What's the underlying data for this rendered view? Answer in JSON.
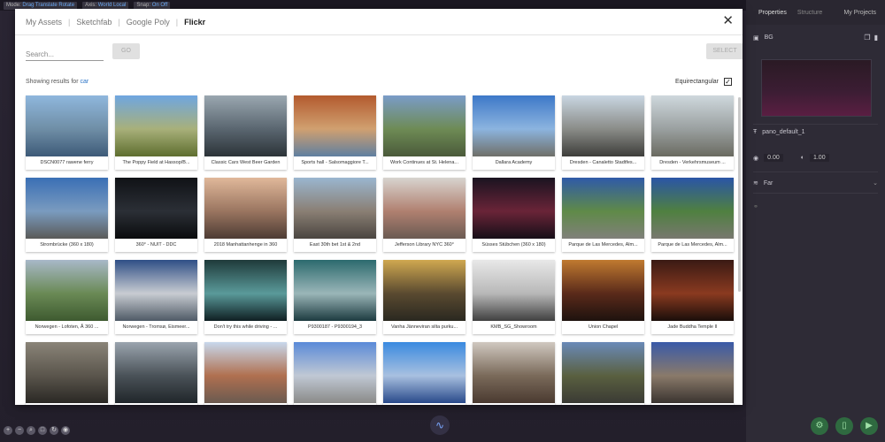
{
  "topbar": {
    "mode_label": "Mode:",
    "mode_values": "Drag  Translate  Rotate",
    "axis_label": "Axis:",
    "axis_values": "World  Local",
    "snap_label": "Snap:",
    "snap_values": "On  Off"
  },
  "right_panel": {
    "tabs": [
      "Properties",
      "Structure"
    ],
    "my_projects": "My Projects",
    "bg_label": "BG",
    "pano_name": "pano_default_1",
    "value_a": "0.00",
    "value_b": "1.00",
    "far_label": "Far"
  },
  "modal": {
    "tabs": [
      {
        "label": "My Assets",
        "active": false
      },
      {
        "label": "Sketchfab",
        "active": false
      },
      {
        "label": "Google Poly",
        "active": false
      },
      {
        "label": "Flickr",
        "active": true
      }
    ],
    "search_placeholder": "Search...",
    "go_label": "GO",
    "select_label": "SELECT",
    "results_prefix": "Showing results for",
    "query": "car",
    "equirectangular_label": "Equirectangular",
    "equirectangular_checked": true,
    "items": [
      {
        "caption": "DSCN0077 rawene ferry",
        "colors": [
          "#8fb7dd",
          "#6f8ea6",
          "#3d5a78"
        ]
      },
      {
        "caption": "The Poppy Field at Hassop/B...",
        "colors": [
          "#6fa6e0",
          "#a8b07a",
          "#5e6e2f"
        ]
      },
      {
        "caption": "Classic Cars West Beer Garden",
        "colors": [
          "#9aa7b0",
          "#5a6670",
          "#2c3338"
        ]
      },
      {
        "caption": "Sports hall - Salsomaggiore T...",
        "colors": [
          "#b35a2e",
          "#d0a070",
          "#5f7fa0"
        ]
      },
      {
        "caption": "Work Continues at St. Helena...",
        "colors": [
          "#7a9cc8",
          "#6e8b55",
          "#4a5a3a"
        ]
      },
      {
        "caption": "Dallara Academy",
        "colors": [
          "#3d78c8",
          "#8cb4df",
          "#6f6f68"
        ]
      },
      {
        "caption": "Dresden - Canaletto Stadtfes...",
        "colors": [
          "#c9d6e2",
          "#8a8c88",
          "#3d3d3a"
        ]
      },
      {
        "caption": "Dresden - Verkehrsmuseum ...",
        "colors": [
          "#cfd8dd",
          "#9aa0a0",
          "#6a6a60"
        ]
      },
      {
        "caption": "Strombrücke (360 x 180)",
        "colors": [
          "#3a6fb5",
          "#7a9bbf",
          "#5a5a58"
        ]
      },
      {
        "caption": "360° - NUIT - DDC",
        "colors": [
          "#101216",
          "#2b2f36",
          "#0a0b0d"
        ]
      },
      {
        "caption": "2018 Manhattanhenge in 360",
        "colors": [
          "#e0b89a",
          "#9a7560",
          "#4d3c34"
        ]
      },
      {
        "caption": "East 30th bet 1st & 2nd",
        "colors": [
          "#9ab6cf",
          "#8a7f74",
          "#4a4540"
        ]
      },
      {
        "caption": "Jefferson Library NYC 360°",
        "colors": [
          "#d8d4cf",
          "#b08070",
          "#6a5a52"
        ]
      },
      {
        "caption": "Süsses Stübchen (360 x 180)",
        "colors": [
          "#1a1320",
          "#6a2438",
          "#160f18"
        ]
      },
      {
        "caption": "Parque de Las Mercedes, Alm...",
        "colors": [
          "#2f5aa8",
          "#5f8a48",
          "#80807a"
        ]
      },
      {
        "caption": "Parque de Las Mercedes, Alm...",
        "colors": [
          "#2a55a6",
          "#4f8040",
          "#78786f"
        ]
      },
      {
        "caption": "Norwegen - Lofoten, Å 360 ...",
        "colors": [
          "#a8b8c8",
          "#6a8a55",
          "#3e5a30"
        ]
      },
      {
        "caption": "Norwegen - Tromsø, Eismeer...",
        "colors": [
          "#2f4f86",
          "#c8ccd2",
          "#4f5a66"
        ]
      },
      {
        "caption": "Don't try this while driving - ...",
        "colors": [
          "#1f3a3a",
          "#5a9a9a",
          "#0f1f22"
        ]
      },
      {
        "caption": "P9300187 - P9300194_3",
        "colors": [
          "#2c6a6e",
          "#9ab6b8",
          "#1d3b40"
        ]
      },
      {
        "caption": "Vanha Jänneviran silta purku...",
        "colors": [
          "#d0a850",
          "#5a4a30",
          "#2a2820"
        ]
      },
      {
        "caption": "KMB_SG_Showroom",
        "colors": [
          "#e8e8e8",
          "#b8b8b8",
          "#404040"
        ]
      },
      {
        "caption": "Union Chapel",
        "colors": [
          "#c07a30",
          "#5a2a1a",
          "#1e120e"
        ]
      },
      {
        "caption": "Jade Buddha Temple II",
        "colors": [
          "#3a1a14",
          "#8a3a20",
          "#1a0e0a"
        ]
      },
      {
        "caption": "",
        "colors": [
          "#8a8478",
          "#5a554c",
          "#2a2824"
        ]
      },
      {
        "caption": "",
        "colors": [
          "#9aa4ae",
          "#4a5258",
          "#20262a"
        ]
      },
      {
        "caption": "",
        "colors": [
          "#c8d8ec",
          "#b07050",
          "#6a5a50"
        ]
      },
      {
        "caption": "",
        "colors": [
          "#5a8ad8",
          "#c0c8d4",
          "#8a8a88"
        ]
      },
      {
        "caption": "",
        "colors": [
          "#3a8ae0",
          "#a8c0e0",
          "#2a4a8a"
        ]
      },
      {
        "caption": "",
        "colors": [
          "#d0c8c0",
          "#7a6a5a",
          "#4a3a30"
        ]
      },
      {
        "caption": "",
        "colors": [
          "#6a8ab8",
          "#5a6040",
          "#3a3a34"
        ]
      },
      {
        "caption": "",
        "colors": [
          "#3a5aa8",
          "#8a7a6a",
          "#3a3430"
        ]
      }
    ]
  }
}
